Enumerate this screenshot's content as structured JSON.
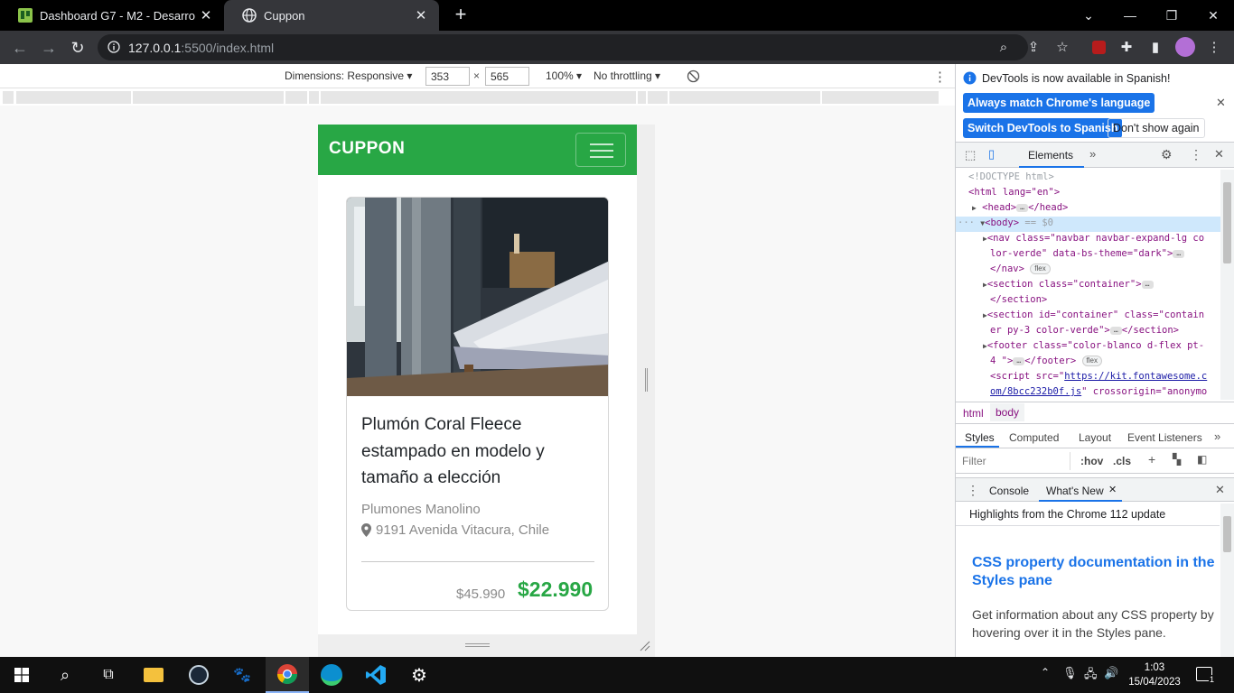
{
  "browser": {
    "tabs": [
      {
        "title": "Dashboard G7 - M2 - Desarrollo",
        "favicon": "trello-like-icon",
        "active": false
      },
      {
        "title": "Cuppon",
        "favicon": "globe-icon",
        "active": true
      }
    ],
    "new_tab": "+",
    "url_host": "127.0.0.1",
    "url_rest": ":5500/index.html"
  },
  "device_toolbar": {
    "dimensions_label": "Dimensions: Responsive",
    "width": "353",
    "times": "×",
    "height": "565",
    "zoom": "100%",
    "throttling": "No throttling"
  },
  "page": {
    "brand": "CUPPON",
    "colors": {
      "green": "#28a745"
    },
    "card": {
      "title": "Plumón Coral Fleece estampado en modelo y tamaño a elección",
      "company": "Plumones Manolino",
      "address": "9191 Avenida Vitacura, Chile",
      "old_price": "$45.990",
      "new_price": "$22.990"
    }
  },
  "devtools": {
    "notice": "DevTools is now available in Spanish!",
    "btn_match": "Always match Chrome's language",
    "btn_switch": "Switch DevTools to Spanish",
    "btn_dont": "Don't show again",
    "panel_tab": "Elements",
    "more": "»",
    "dom": {
      "doctype": "<!DOCTYPE html>",
      "html_open": "<html lang=\"en\">",
      "head": "<head>",
      "head_close": "</head>",
      "body": "<body>",
      "body_eq": "== $0",
      "nav_1": "<nav class=\"navbar navbar-expand-lg co",
      "nav_2": "lor-verde\" data-bs-theme=\"dark\">",
      "nav_close": "</nav>",
      "flex": "flex",
      "section_1": "<section class=\"container\">",
      "section_close": "</section>",
      "section2_1": "<section id=\"container\" class=\"contain",
      "section2_2": "er py-3 color-verde\">",
      "section2_close": "</section>",
      "footer_1": "<footer class=\"color-blanco d-flex pt-",
      "footer_2": "4 \">",
      "footer_close": "</footer>",
      "script_1": "<script src=\"",
      "script_link_1": "https://kit.fontawesome.c",
      "script_link_2": "om/8bcc232b0f.js",
      "script_2": "\" crossorigin=\"anonymo"
    },
    "breadcrumbs": [
      "html",
      "body"
    ],
    "style_tabs": [
      "Styles",
      "Computed",
      "Layout",
      "Event Listeners"
    ],
    "filter_placeholder": "Filter",
    "hov": ":hov",
    "cls": ".cls",
    "drawer_tabs": [
      "Console",
      "What's New"
    ],
    "whatsnew_heading": "Highlights from the Chrome 112 update",
    "whatsnew_title": "CSS property documentation in the Styles pane",
    "whatsnew_body": "Get information about any CSS property by hovering over it in the Styles pane."
  },
  "taskbar": {
    "time": "1:03",
    "date": "15/04/2023",
    "notifications": "1"
  }
}
